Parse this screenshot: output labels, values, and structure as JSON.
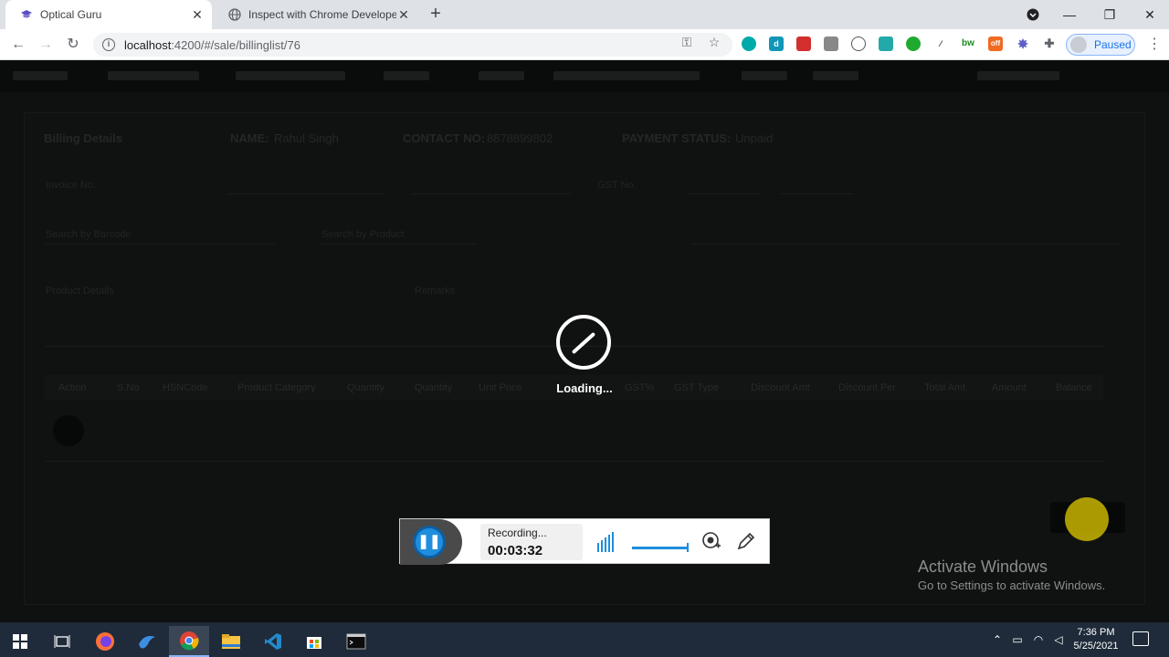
{
  "browser": {
    "tabs": [
      {
        "title": "Optical Guru",
        "active": true
      },
      {
        "title": "Inspect with Chrome Developer T",
        "active": false
      }
    ],
    "url_host": "localhost",
    "url_path": ":4200/#/sale/billinglist/76",
    "profile_label": "Paused",
    "extensions": [
      "d",
      "bw",
      "off"
    ]
  },
  "page": {
    "title": "Billing Details",
    "name_label": "NAME:",
    "name_value": "Rahul Singh",
    "contact_label": "CONTACT NO:",
    "contact_value": "8878899802",
    "payment_label": "PAYMENT STATUS:",
    "payment_value": "Unpaid",
    "invoice_label": "Invoice No.",
    "gst_label": "GST No.",
    "search_barcode_label": "Search by Barcode",
    "search_product_label": "Search by Product",
    "product_details_label": "Product Details",
    "remarks_label": "Remarks",
    "table_headers": [
      "Action",
      "S.No",
      "HSNCode",
      "Product Category",
      "Quantity",
      "Quantity",
      "Unit Price",
      "Discount",
      "GST%",
      "GST Type",
      "Discount Amt",
      "Discount Per",
      "Total Amt",
      "Amount",
      "Balance"
    ]
  },
  "overlay": {
    "loading_text": "Loading..."
  },
  "recorder": {
    "status": "Recording...",
    "time": "00:03:32"
  },
  "watermark": {
    "title": "Activate Windows",
    "subtitle": "Go to Settings to activate Windows."
  },
  "taskbar": {
    "time": "7:36 PM",
    "date": "5/25/2021"
  }
}
